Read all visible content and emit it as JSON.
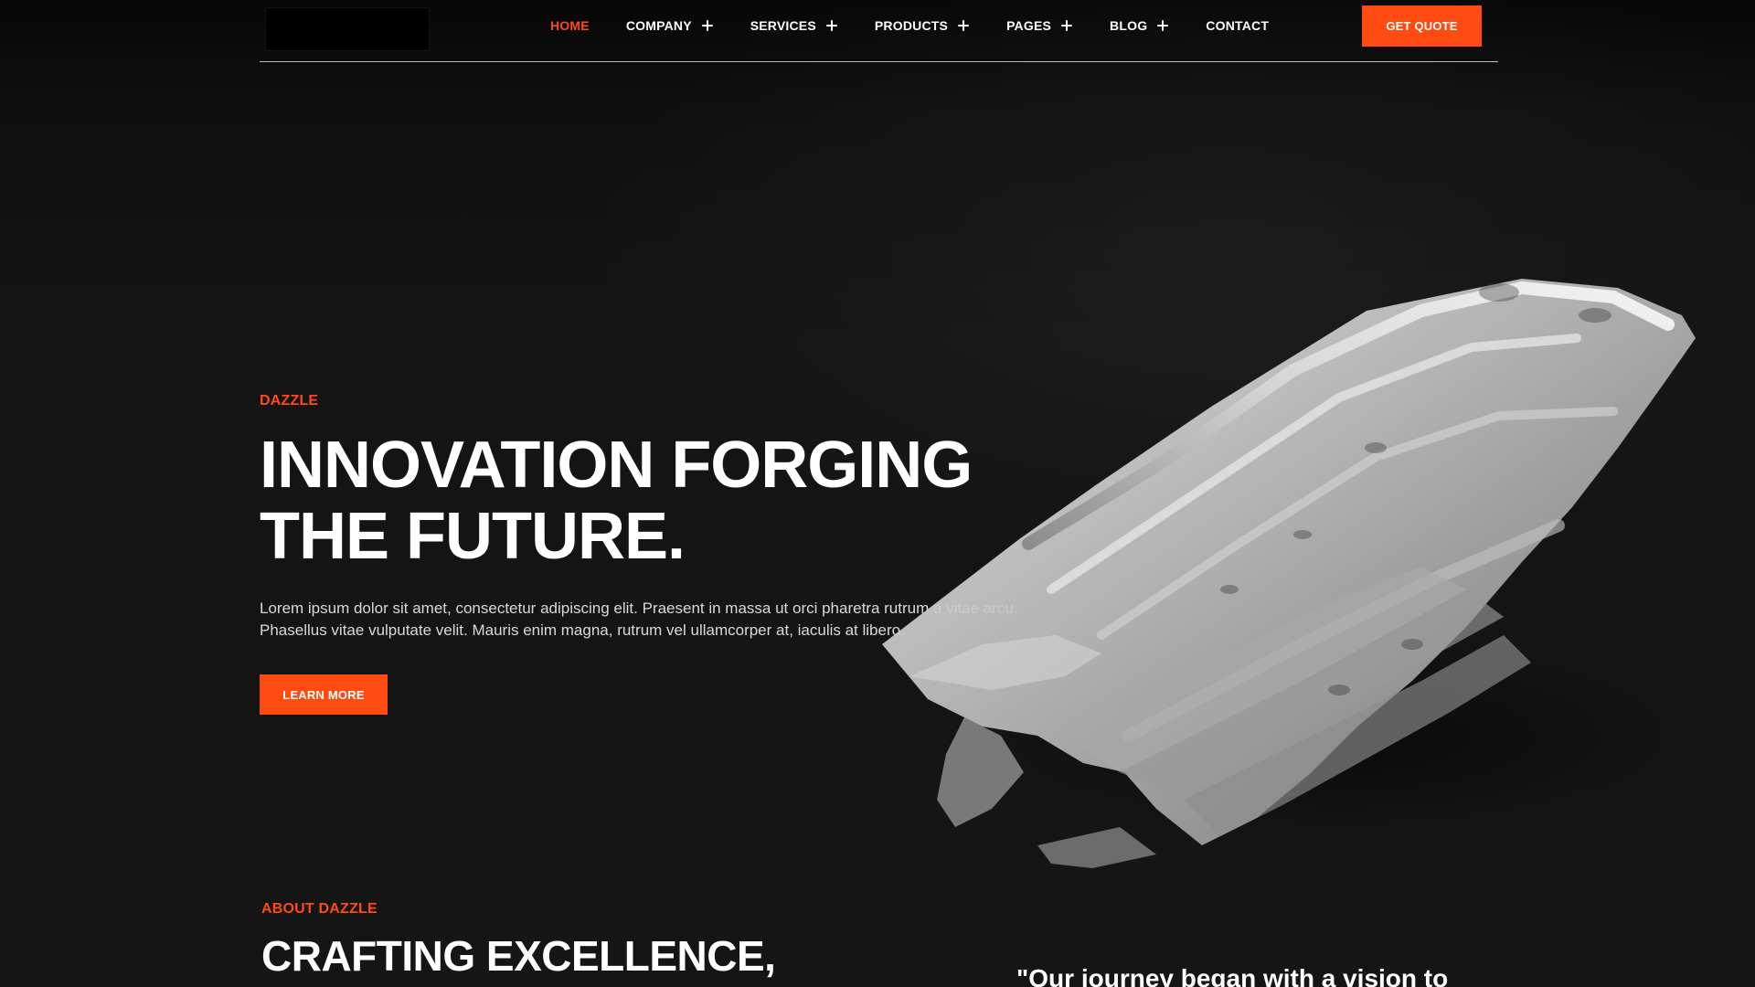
{
  "colors": {
    "accent": "#ff4a12",
    "background": "#141414",
    "text": "#ffffff"
  },
  "nav": {
    "items": [
      {
        "label": "HOME",
        "active": true,
        "has_plus": false
      },
      {
        "label": "COMPANY",
        "active": false,
        "has_plus": true
      },
      {
        "label": "SERVICES",
        "active": false,
        "has_plus": true
      },
      {
        "label": "PRODUCTS",
        "active": false,
        "has_plus": true
      },
      {
        "label": "PAGES",
        "active": false,
        "has_plus": true
      },
      {
        "label": "BLOG",
        "active": false,
        "has_plus": true
      },
      {
        "label": "CONTACT",
        "active": false,
        "has_plus": false
      }
    ],
    "quote_button": "GET QUOTE"
  },
  "hero": {
    "eyebrow": "DAZZLE",
    "title_line1": "INNOVATION FORGING",
    "title_line2": "THE FUTURE.",
    "description_line1": "Lorem ipsum dolor sit amet, consectetur adipiscing elit. Praesent in massa ut orci pharetra rutrum a vitae arcu.",
    "description_line2": "Phasellus vitae vulputate velit. Mauris enim magna, rutrum vel ullamcorper at, iaculis at libero.",
    "cta": "LEARN MORE"
  },
  "about": {
    "eyebrow": "ABOUT DAZZLE",
    "title_line1": "CRAFTING EXCELLENCE,",
    "quote_snippet": "\"Our journey began with a vision to"
  },
  "icons": {
    "nav_expand": "plus-icon"
  }
}
